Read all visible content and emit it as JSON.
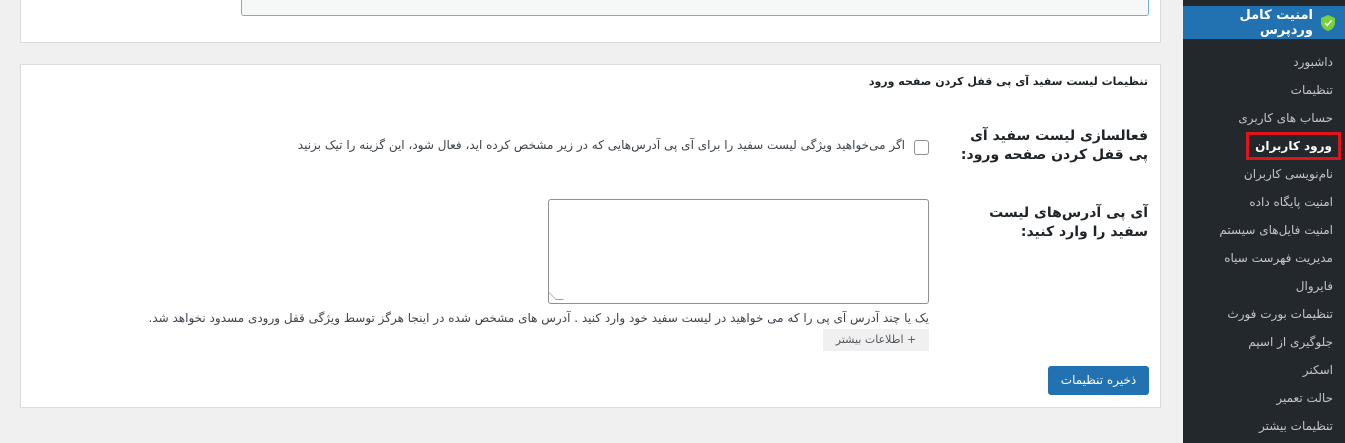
{
  "sidebar": {
    "header_title": "امنیت کامل وردپرس",
    "header_icon": "shield-icon",
    "items": [
      {
        "label": "داشبورد",
        "current": false
      },
      {
        "label": "تنظیمات",
        "current": false
      },
      {
        "label": "حساب های کاربری",
        "current": false
      },
      {
        "label": "ورود کاربران",
        "current": true
      },
      {
        "label": "نام‌نویسی کاربران",
        "current": false
      },
      {
        "label": "امنیت پایگاه داده",
        "current": false
      },
      {
        "label": "امنیت فایل‌های سیستم",
        "current": false
      },
      {
        "label": "مدیریت فهرست سیاه",
        "current": false
      },
      {
        "label": "فایروال",
        "current": false
      },
      {
        "label": "تنظیمات بورت فورث",
        "current": false
      },
      {
        "label": "جلوگیری از اسپم",
        "current": false
      },
      {
        "label": "اسکنر",
        "current": false
      },
      {
        "label": "حالت تعمیر",
        "current": false
      },
      {
        "label": "تنظیمات بیشتر",
        "current": false
      }
    ],
    "highlight_color": "#e1141b",
    "accent": "#2271b1"
  },
  "card": {
    "title": "تنظیمات لیست سفید آی پی قفل کردن صفحه ورود",
    "enable_label": "فعالسازی لیست سفید آی پی قفل کردن صفحه ورود:",
    "enable_checked": false,
    "enable_desc": "اگر می‌خواهید ویژگی لیست سفید را برای آی پی آدرس‌هایی که در زیر مشخص کرده اید، فعال شود، این گزینه را تیک بزنید",
    "ip_label": "آی پی آدرس‌های لیست سفید را وارد کنید:",
    "ip_value": "",
    "help_text": "یک یا چند آدرس آی پی را که می خواهید در لیست سفید خود وارد کنید . آدرس های مشخص شده در اینجا هرگز توسط ویژگی قفل ورودی مسدود نخواهد شد.",
    "more_info": "+ اطلاعات بیشتر",
    "save_label": "ذخیره تنظیمات"
  }
}
